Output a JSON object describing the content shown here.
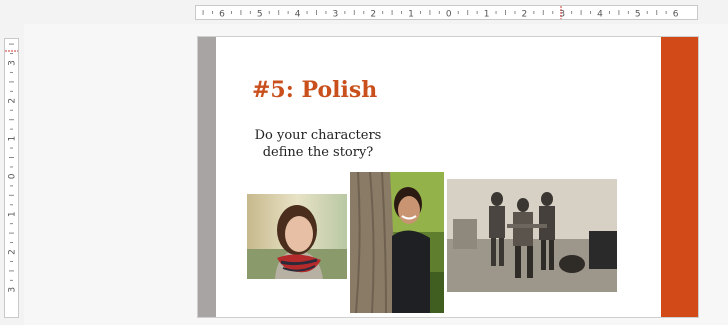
{
  "rulers": {
    "horizontal_labels": [
      "6",
      "5",
      "4",
      "3",
      "2",
      "1",
      "0",
      "1",
      "2",
      "3",
      "4",
      "5",
      "6"
    ],
    "vertical_labels": [
      "3",
      "2",
      "1",
      "0",
      "1",
      "2",
      "3"
    ]
  },
  "slide": {
    "title": "#5: Polish",
    "body_lines": [
      "Do your characters",
      "define the story?"
    ],
    "images": [
      "woman-portrait-photo",
      "man-behind-tree-photo",
      "street-musicians-photo"
    ]
  },
  "colors": {
    "accent": "#d24a17",
    "title": "#c9501c",
    "side_bar": "#a8a4a3"
  }
}
